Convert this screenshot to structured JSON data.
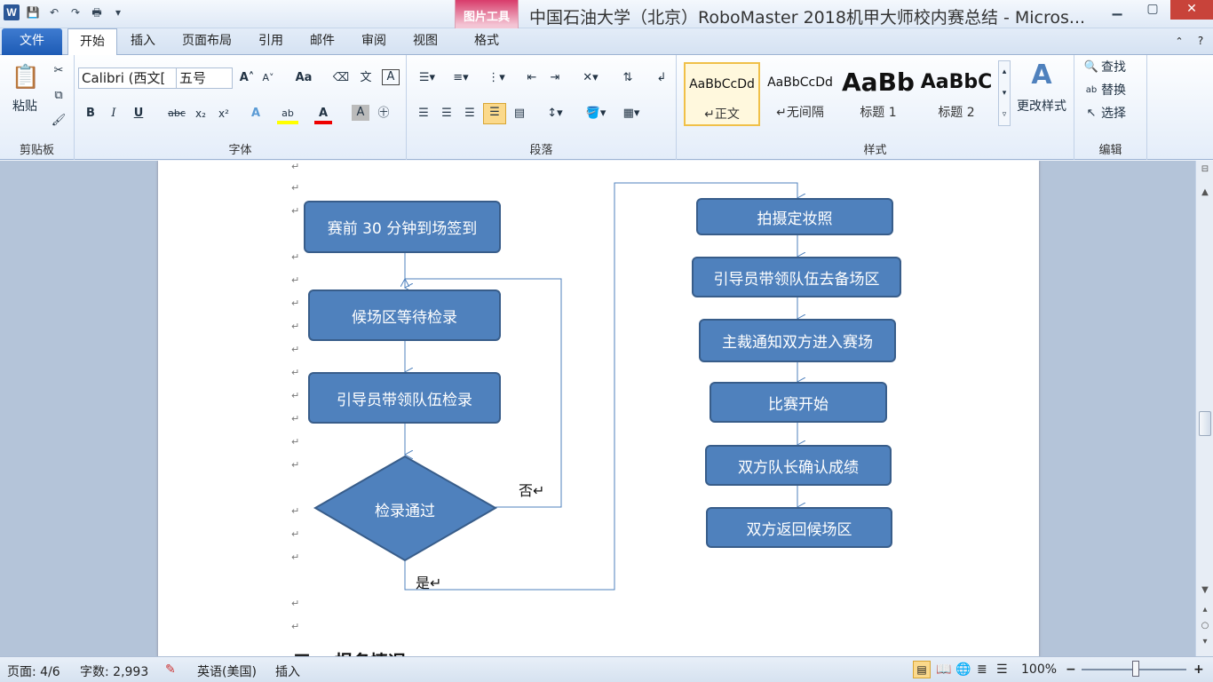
{
  "window": {
    "title": "中国石油大学（北京）RoboMaster 2018机甲大师校内赛总结 - Micros...",
    "context_tab_group": "图片工具",
    "controls": {
      "minimize": "▁",
      "maximize": "▢",
      "close": "✕"
    }
  },
  "quick_access": {
    "word_icon": "W",
    "save": "💾",
    "undo": "↶",
    "redo": "↷",
    "print": "🖶",
    "customize": "▾"
  },
  "tabs": [
    {
      "label": "文件"
    },
    {
      "label": "开始"
    },
    {
      "label": "插入"
    },
    {
      "label": "页面布局"
    },
    {
      "label": "引用"
    },
    {
      "label": "邮件"
    },
    {
      "label": "审阅"
    },
    {
      "label": "视图"
    },
    {
      "label": "格式"
    }
  ],
  "ribbon": {
    "clipboard": {
      "paste_label": "粘贴",
      "group": "剪贴板"
    },
    "font": {
      "font_name": "Calibri (西文[",
      "font_size": "五号",
      "grow": "A˄",
      "shrink": "A˅",
      "change_case": "Aa",
      "bold": "B",
      "italic": "I",
      "underline": "U",
      "strike": "abc",
      "subscript": "x₂",
      "superscript": "x²",
      "group": "字体"
    },
    "paragraph": {
      "group": "段落"
    },
    "styles": {
      "items": [
        {
          "preview": "AaBbCcDd",
          "name": "↵正文"
        },
        {
          "preview": "AaBbCcDd",
          "name": "↵无间隔"
        },
        {
          "preview": "AaBb",
          "name": "标题 1"
        },
        {
          "preview": "AaBbC",
          "name": "标题 2"
        }
      ],
      "change_styles": "更改样式",
      "group": "样式"
    },
    "editing": {
      "find": "查找",
      "replace": "替换",
      "select": "选择",
      "group": "编辑"
    }
  },
  "document": {
    "flow_left": {
      "checkin": "赛前 30 分钟到场签到",
      "waiting": "候场区等待检录",
      "guide_check": "引导员带领队伍检录",
      "pass_check": "检录通过",
      "no_label": "否↵",
      "yes_label": "是↵"
    },
    "flow_right": [
      "拍摄定妆照",
      "引导员带领队伍去备场区",
      "主裁通知双方进入赛场",
      "比赛开始",
      "双方队长确认成绩",
      "双方返回候场区"
    ],
    "return_mark": "↵",
    "next_heading": "三、  报名情况"
  },
  "status": {
    "page": "页面: 4/6",
    "words": "字数: 2,993",
    "language": "英语(美国)",
    "mode": "插入",
    "zoom": "100%",
    "zoom_minus": "−",
    "zoom_plus": "+"
  }
}
